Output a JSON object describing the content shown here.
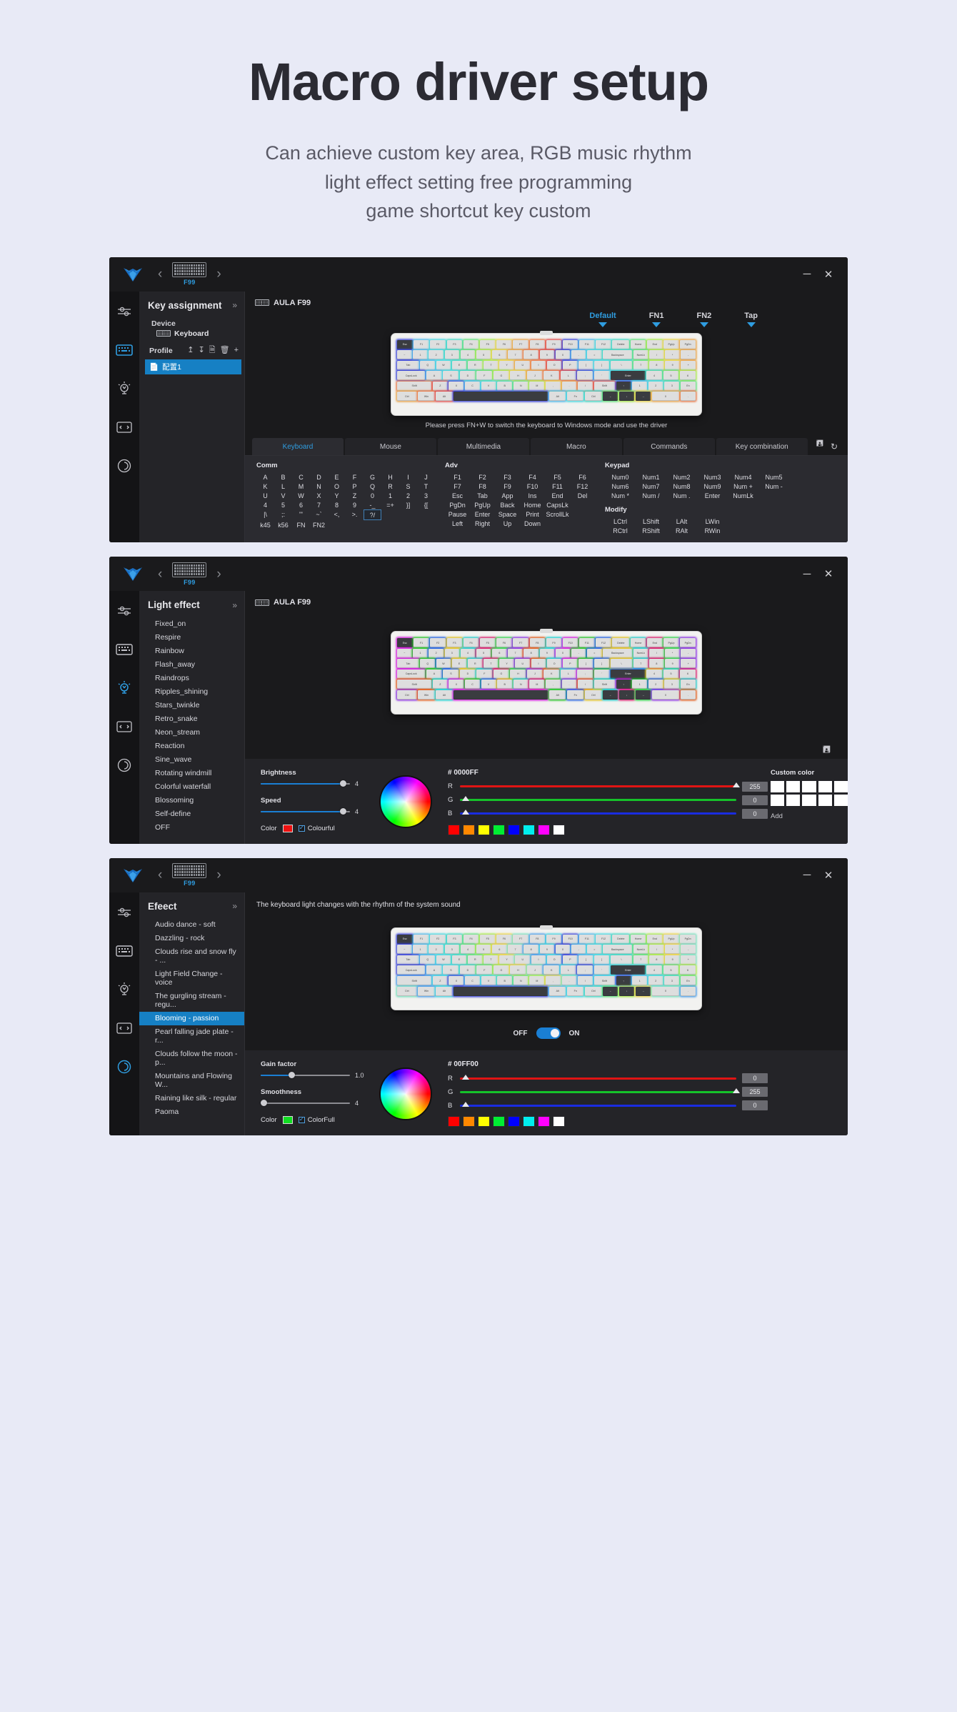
{
  "hero": {
    "title": "Macro driver setup",
    "subtitle_line1": "Can achieve custom key area, RGB music rhythm",
    "subtitle_line2": "light effect setting free programming",
    "subtitle_line3": "game shortcut key custom"
  },
  "titlebar": {
    "model": "F99",
    "prev_icon": "‹",
    "next_icon": "›",
    "minimize": "─",
    "close": "✕"
  },
  "panel1": {
    "sidebar": {
      "title": "Key assignment",
      "collapse_icon": "»",
      "device_label": "Device",
      "device_name": "Keyboard",
      "profile_label": "Profile",
      "profile_actions": [
        "export",
        "import",
        "duplicate",
        "delete",
        "add"
      ],
      "profile_item": "配置1"
    },
    "device_title": "AULA F99",
    "layers": [
      {
        "label": "Default",
        "active": true
      },
      {
        "label": "FN1",
        "active": false
      },
      {
        "label": "FN2",
        "active": false
      },
      {
        "label": "Tap",
        "active": false
      }
    ],
    "hint": "Please press FN+W to switch the keyboard to Windows mode and use the driver",
    "tabs": [
      {
        "label": "Keyboard",
        "active": true
      },
      {
        "label": "Mouse",
        "active": false
      },
      {
        "label": "Multimedia",
        "active": false
      },
      {
        "label": "Macro",
        "active": false
      },
      {
        "label": "Commands",
        "active": false
      },
      {
        "label": "Key combination",
        "active": false
      }
    ],
    "tab_actions": [
      "save-icon",
      "reset-icon"
    ],
    "keygrid": {
      "comm_header": "Comm",
      "comm_rows": [
        [
          "A",
          "B",
          "C",
          "D",
          "E",
          "F",
          "G",
          "H",
          "I",
          "J"
        ],
        [
          "K",
          "L",
          "M",
          "N",
          "O",
          "P",
          "Q",
          "R",
          "S",
          "T"
        ],
        [
          "U",
          "V",
          "W",
          "X",
          "Y",
          "Z",
          "0",
          "1",
          "2",
          "3"
        ],
        [
          "4",
          "5",
          "6",
          "7",
          "8",
          "9",
          "-_",
          "=+",
          "}]",
          "{["
        ],
        [
          "|\\",
          ";:",
          "\"'",
          "~`",
          "<,",
          ">.",
          "?/"
        ],
        [
          "k45",
          "k56",
          "FN",
          "FN2"
        ]
      ],
      "comm_selected": "?/",
      "adv_header": "Adv",
      "adv_rows": [
        [
          "F1",
          "F2",
          "F3",
          "F4",
          "F5",
          "F6"
        ],
        [
          "F7",
          "F8",
          "F9",
          "F10",
          "F11",
          "F12"
        ],
        [
          "Esc",
          "Tab",
          "App",
          "Ins",
          "End",
          "Del"
        ],
        [
          "PgDn",
          "PgUp",
          "Back",
          "Home",
          "CapsLk"
        ],
        [
          "Pause",
          "Enter",
          "Space",
          "Print",
          "ScrollLk"
        ],
        [
          "Left",
          "Right",
          "Up",
          "Down"
        ]
      ],
      "keypad_header": "Keypad",
      "keypad_rows": [
        [
          "Num0",
          "Num1",
          "Num2",
          "Num3",
          "Num4",
          "Num5"
        ],
        [
          "Num6",
          "Num7",
          "Num8",
          "Num9",
          "Num +",
          "Num -"
        ],
        [
          "Num *",
          "Num /",
          "Num .",
          "Enter",
          "NumLk"
        ]
      ],
      "modify_header": "Modify",
      "modify_rows": [
        [
          "LCtrl",
          "LShift",
          "LAlt",
          "LWin"
        ],
        [
          "RCtrl",
          "RShift",
          "RAlt",
          "RWin"
        ]
      ]
    }
  },
  "panel2": {
    "sidebar": {
      "title": "Light effect",
      "collapse_icon": "»",
      "items": [
        "Fixed_on",
        "Respire",
        "Rainbow",
        "Flash_away",
        "Raindrops",
        "Ripples_shining",
        "Stars_twinkle",
        "Retro_snake",
        "Neon_stream",
        "Reaction",
        "Sine_wave",
        "Rotating windmill",
        "Colorful waterfall",
        "Blossoming",
        "Self-define",
        "OFF"
      ],
      "selected": null
    },
    "device_title": "AULA F99",
    "controls": {
      "brightness_label": "Brightness",
      "brightness_value": "4",
      "brightness_pct": 92,
      "speed_label": "Speed",
      "speed_value": "4",
      "speed_pct": 92,
      "color_label": "Color",
      "color_swatch": "#ee1111",
      "colourful_label": "Colourful",
      "colourful_checked": true,
      "hex": "# 0000FF",
      "rgb": [
        {
          "ch": "R",
          "value": "255",
          "pct": 100,
          "color": "#e01414"
        },
        {
          "ch": "G",
          "value": "0",
          "pct": 2,
          "color": "#15c22a"
        },
        {
          "ch": "B",
          "value": "0",
          "pct": 2,
          "color": "#1a2ce0"
        }
      ],
      "presets": [
        "#ff0000",
        "#ff8800",
        "#ffff00",
        "#00ee33",
        "#0000ff",
        "#00eeee",
        "#ff00ff",
        "#ffffff"
      ],
      "custom_color_label": "Custom color",
      "custom_swatch_count": 10,
      "add_label": "Add",
      "save_icon": "save-icon"
    }
  },
  "panel3": {
    "sidebar": {
      "title": "Efeect",
      "collapse_icon": "»",
      "items": [
        "Audio dance - soft",
        "Dazzling - rock",
        "Clouds rise and snow fly - ...",
        "Light Field Change - voice",
        "The gurgling stream - regu...",
        "Blooming - passion",
        "Pearl falling jade plate - r...",
        "Clouds follow the moon - p...",
        "Mountains and Flowing W...",
        "Raining like silk - regular",
        "Paoma"
      ],
      "selected": "Blooming - passion"
    },
    "hint": "The keyboard light changes with the rhythm of the system sound",
    "toggle": {
      "off_label": "OFF",
      "on_label": "ON",
      "state": "on"
    },
    "controls": {
      "gain_label": "Gain factor",
      "gain_value": "1.0",
      "gain_pct": 34,
      "smoothness_label": "Smoothness",
      "smoothness_value": "4",
      "smoothness_pct": 3,
      "color_label": "Color",
      "color_swatch": "#11dd22",
      "colorfull_label": "ColorFull",
      "colorfull_checked": true,
      "hex": "# 00FF00",
      "rgb": [
        {
          "ch": "R",
          "value": "0",
          "pct": 2,
          "color": "#e01414"
        },
        {
          "ch": "G",
          "value": "255",
          "pct": 100,
          "color": "#15c22a"
        },
        {
          "ch": "B",
          "value": "0",
          "pct": 2,
          "color": "#1a2ce0"
        }
      ],
      "presets": [
        "#ff0000",
        "#ff8800",
        "#ffff00",
        "#00ee33",
        "#0000ff",
        "#00eeee",
        "#ff00ff",
        "#ffffff"
      ]
    }
  },
  "theme": {
    "accent": "#1680c4",
    "accent_text": "#2f9de0",
    "window_bg": "#1a1a1c",
    "sidebar_bg": "#242428",
    "page_bg": "#e8eaf6"
  }
}
